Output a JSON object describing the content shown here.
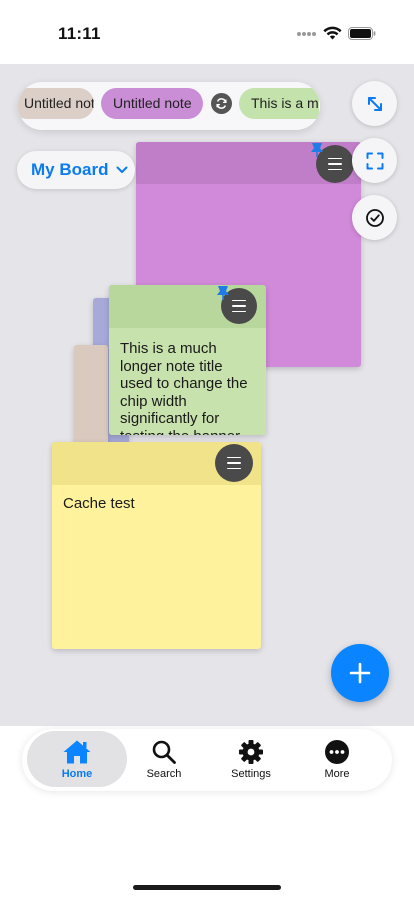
{
  "status_bar": {
    "time": "11:11"
  },
  "chips": [
    {
      "label": "Untitled note",
      "color": "#dbcfc7"
    },
    {
      "label": "Untitled note",
      "color": "#c98ed6"
    },
    {
      "label": "This is a much longer note title used to change the chip width significantly for testing the banner",
      "color": "#c4e2ab"
    }
  ],
  "board_selector": {
    "label": "My Board"
  },
  "tool_buttons": [
    {
      "icon": "expand-arrows-icon"
    },
    {
      "icon": "fit-screen-icon"
    },
    {
      "icon": "checkmark-circle-icon"
    }
  ],
  "notes": [
    {
      "text": "",
      "color": "#d08ad9",
      "header_color": "#c07ec9",
      "pinned": true
    },
    {
      "text": "This is a much longer note title used to change the chip width significantly for testing the banner",
      "color": "#c8e2ad",
      "header_color": "#b8d79c",
      "pinned": true
    },
    {
      "text": "Cache test",
      "color": "#fff29c",
      "header_color": "#f1e38a",
      "pinned": false
    }
  ],
  "add_button": {
    "icon": "plus-icon"
  },
  "tabs": [
    {
      "label": "Home",
      "icon": "home-icon",
      "active": true
    },
    {
      "label": "Search",
      "icon": "search-icon",
      "active": false
    },
    {
      "label": "Settings",
      "icon": "gear-icon",
      "active": false
    },
    {
      "label": "More",
      "icon": "more-icon",
      "active": false
    }
  ],
  "colors": {
    "accent": "#0a84ff",
    "board_background": "#e4e4e9"
  }
}
